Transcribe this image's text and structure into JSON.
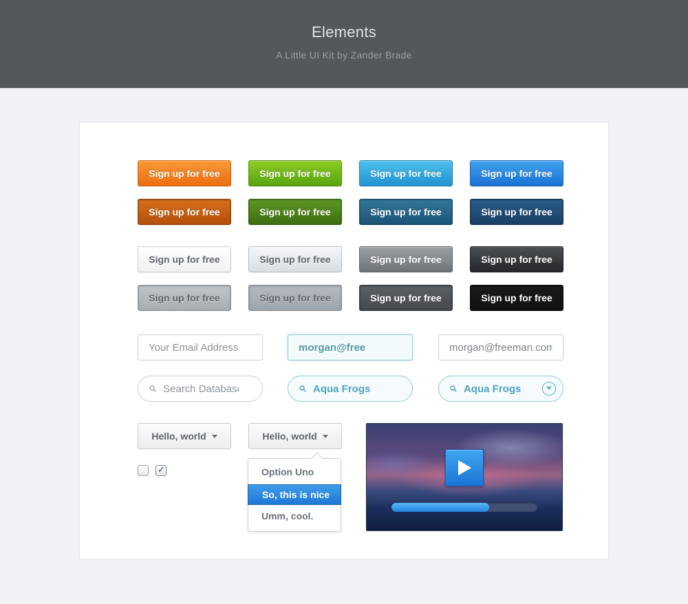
{
  "header": {
    "title": "Elements",
    "subtitle": "A Little UI Kit by Zander Brade"
  },
  "buttons": {
    "label": "Sign up for free"
  },
  "inputs": {
    "email_placeholder": "Your Email Address",
    "focused_value": "morgan@free",
    "filled_value": "morgan@freeman.com"
  },
  "search": {
    "placeholder": "Search Database",
    "aqua_value": "Aqua Frogs",
    "aqua_dropdown_value": "Aqua Frogs"
  },
  "dropdowns": {
    "label": "Hello, world",
    "options": [
      "Option Uno",
      "So, this is nice",
      "Umm, cool."
    ],
    "selected_index": 1
  },
  "checkboxes": [
    {
      "checked": false
    },
    {
      "checked": true
    }
  ],
  "video": {
    "progress": 0.67
  },
  "colors": {
    "header_bg": "#54585c",
    "page_bg": "#f0f2f5",
    "orange": "#ec6d12",
    "green": "#5aa410",
    "cyan": "#2192cf",
    "blue": "#1a72d4",
    "aqua_border": "#8fcad2"
  },
  "icons": {
    "search": "search-icon",
    "check": "check-icon",
    "caret": "chevron-down-icon",
    "play": "play-icon"
  }
}
